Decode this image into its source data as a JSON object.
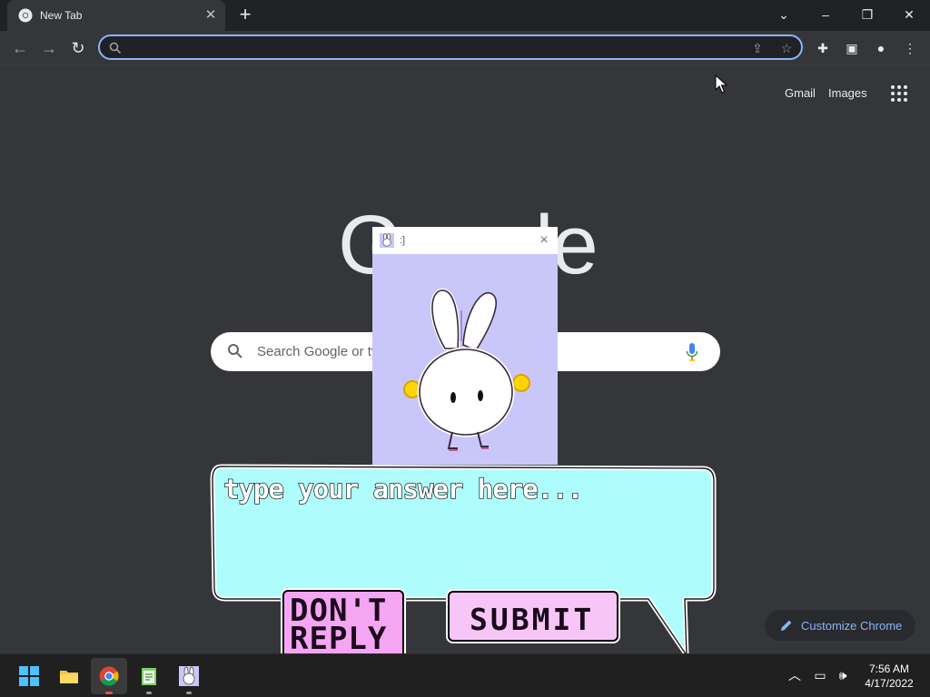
{
  "browser": {
    "tab_title": "New Tab",
    "omnibox_value": "",
    "omnibox_placeholder": ""
  },
  "ntp": {
    "links": [
      "Gmail",
      "Images"
    ],
    "logo_text": "Google",
    "search_placeholder": "Search Google or type a URL",
    "customize_label": "Customize Chrome"
  },
  "popup": {
    "title": ":]",
    "close_glyph": "×"
  },
  "prompt": {
    "answer_placeholder": "type your answer here...",
    "dont_reply_label": "DON'T\nREPLY",
    "submit_label": "SUBMIT"
  },
  "taskbar": {
    "apps": [
      "start-icon",
      "file-explorer-icon",
      "chrome-icon",
      "notepad-icon",
      "bunny-app-icon"
    ],
    "time": "7:56 AM",
    "date": "4/17/2022"
  },
  "colors": {
    "bubble": "#aefcfc",
    "popup_bg": "#c9c7f9",
    "dont_reply_bg": "#f5a6f3",
    "submit_bg": "#f7c6f7",
    "accent": "#8ab4f8"
  }
}
